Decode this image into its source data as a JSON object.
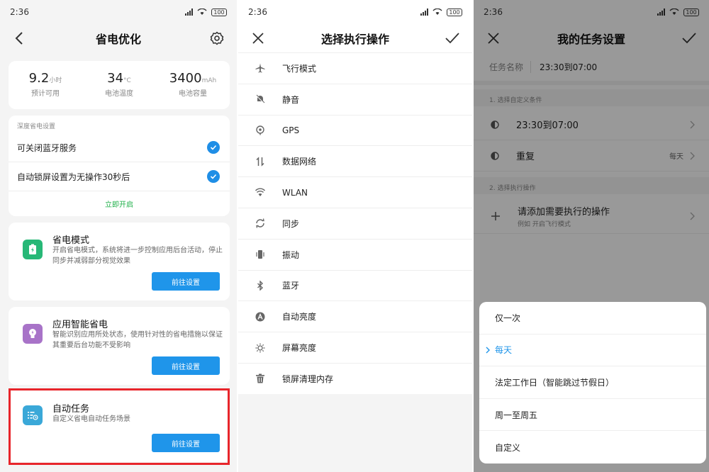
{
  "status_bar": {
    "time": "2:36",
    "battery": "100"
  },
  "panel1": {
    "title": "省电优化",
    "stats": [
      {
        "value": "9.2",
        "unit": "小时",
        "label": "预计可用"
      },
      {
        "value": "34",
        "unit": "°C",
        "label": "电池温度"
      },
      {
        "value": "3400",
        "unit": "mAh",
        "label": "电池容量"
      }
    ],
    "deep": {
      "title": "深度省电设置",
      "items": [
        "可关闭蓝牙服务",
        "自动锁屏设置为无操作30秒后"
      ],
      "action": "立即开启"
    },
    "features": [
      {
        "name": "省电模式",
        "desc": "开启省电模式，系统将进一步控制应用后台活动，停止同步并减弱部分视觉效果",
        "button": "前往设置"
      },
      {
        "name": "应用智能省电",
        "desc": "智能识别应用所处状态，使用针对性的省电措施以保证其重要后台功能不受影响",
        "button": "前往设置"
      },
      {
        "name": "自动任务",
        "desc": "自定义省电自动任务场景",
        "button": "前往设置"
      }
    ]
  },
  "panel2": {
    "title": "选择执行操作",
    "actions": [
      "飞行模式",
      "静音",
      "GPS",
      "数据网络",
      "WLAN",
      "同步",
      "振动",
      "蓝牙",
      "自动亮度",
      "屏幕亮度",
      "锁屏清理内存"
    ]
  },
  "panel3": {
    "title": "我的任务设置",
    "task_name_label": "任务名称",
    "task_name_value": "23:30到07:00",
    "section1": "1. 选择自定义条件",
    "condition_time": "23:30到07:00",
    "repeat_label": "重复",
    "repeat_value": "每天",
    "section2": "2. 选择执行操作",
    "add_title": "请添加需要执行的操作",
    "add_hint": "例如 开启飞行模式",
    "sheet_options": [
      "仅一次",
      "每天",
      "法定工作日（智能跳过节假日）",
      "周一至周五",
      "自定义"
    ],
    "selected_option": "每天"
  },
  "colors": {
    "accent": "#1f95ea",
    "check": "#1f8ee6",
    "green": "#20b04a",
    "highlight": "#e8252b"
  }
}
